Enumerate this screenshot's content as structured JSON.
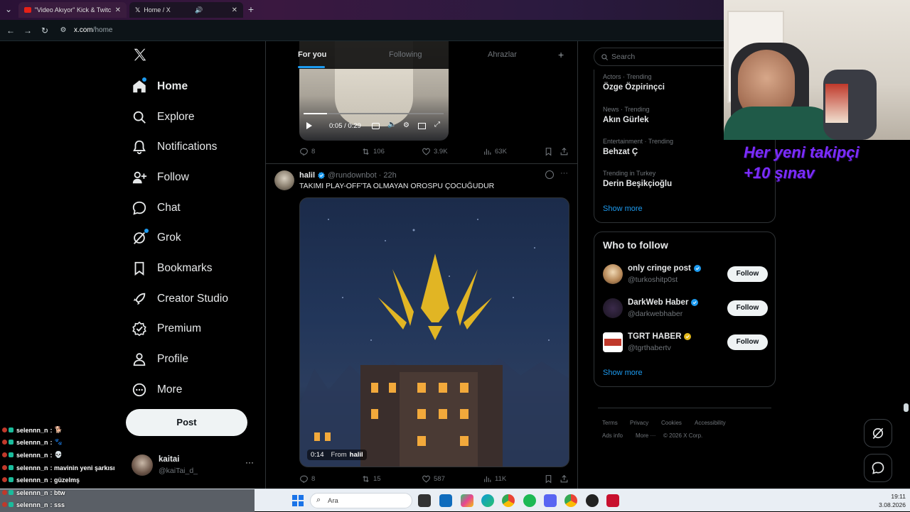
{
  "browser": {
    "tabs": [
      {
        "title": "\"Video Akıyor\" Kick & Twitch K",
        "active": false
      },
      {
        "title": "Home / X",
        "active": true
      }
    ],
    "url": "x.com/home",
    "url_host": "x.com",
    "url_path": "/home"
  },
  "sidebar": {
    "items": [
      {
        "label": "Home",
        "icon": "home-icon"
      },
      {
        "label": "Explore",
        "icon": "search-icon"
      },
      {
        "label": "Notifications",
        "icon": "bell-icon"
      },
      {
        "label": "Follow",
        "icon": "person-add-icon"
      },
      {
        "label": "Chat",
        "icon": "chat-icon"
      },
      {
        "label": "Grok",
        "icon": "grok-icon"
      },
      {
        "label": "Bookmarks",
        "icon": "bookmark-icon"
      },
      {
        "label": "Creator Studio",
        "icon": "rocket-icon"
      },
      {
        "label": "Premium",
        "icon": "verified-badge-icon"
      },
      {
        "label": "Profile",
        "icon": "person-icon"
      },
      {
        "label": "More",
        "icon": "more-circle-icon"
      }
    ],
    "post_label": "Post",
    "account": {
      "name": "kaitai",
      "handle": "@kaiTai_d_"
    }
  },
  "feed": {
    "tabs": [
      "For you",
      "Following",
      "Ahrazlar"
    ],
    "active_tab": "For you",
    "posts": [
      {
        "video_time": "0:05 / 0:29",
        "video_progress": 0.17,
        "replies": "8",
        "reposts": "106",
        "likes": "3.9K",
        "views": "63K"
      },
      {
        "author": "halil",
        "handle": "@rundownbot",
        "time": "22h",
        "text": "TAKIMI PLAY-OFF'TA OLMAYAN OROSPU ÇOCUĞUDUR",
        "video_duration": "0:14",
        "video_from_label": "From",
        "video_from": "halil",
        "replies": "8",
        "reposts": "15",
        "likes": "587",
        "views": "11K"
      }
    ]
  },
  "right": {
    "search_placeholder": "Search",
    "trends": [
      {
        "category": "Actors · Trending",
        "name": "Özge Özpirinçci"
      },
      {
        "category": "News · Trending",
        "name": "Akın Gürlek"
      },
      {
        "category": "Entertainment · Trending",
        "name": "Behzat Ç"
      },
      {
        "category": "Trending in Turkey",
        "name": "Derin Beşikçioğlu"
      }
    ],
    "trends_show_more": "Show more",
    "who_to_follow_title": "Who to follow",
    "who_to_follow": [
      {
        "name": "only cringe post",
        "handle": "@turkoshitp0st",
        "badge": "blue",
        "button": "Follow"
      },
      {
        "name": "DarkWeb Haber",
        "handle": "@darkwebhaber",
        "badge": "blue",
        "button": "Follow"
      },
      {
        "name": "TGRT HABER",
        "handle": "@tgrthabertv",
        "badge": "gold",
        "button": "Follow"
      }
    ],
    "wtf_show_more": "Show more",
    "footer": [
      "Terms",
      "Privacy",
      "Cookies",
      "Accessibility",
      "Ads info",
      "More ···",
      "© 2026 X Corp."
    ]
  },
  "stream_overlay": {
    "text_line1": "Her yeni takipçi",
    "text_line2": "+10 şınav"
  },
  "chat": [
    {
      "user": "selennn_n",
      "msg": ":"
    },
    {
      "user": "selennn_n",
      "msg": ":"
    },
    {
      "user": "selennn_n",
      "msg": ":"
    },
    {
      "user": "selennn_n",
      "msg": ": mavinin yeni şarkısı"
    },
    {
      "user": "selennn_n",
      "msg": ": güzelmş"
    },
    {
      "user": "selennn_n",
      "msg": ": btw"
    },
    {
      "user": "selennn_n",
      "msg": ": sss"
    }
  ],
  "taskbar": {
    "search_label": "Ara",
    "time": "19:11",
    "date": "3.08.2026"
  },
  "colors": {
    "accent": "#1d9bf0",
    "bg": "#000000",
    "overlay_text": "#7b2cff"
  }
}
